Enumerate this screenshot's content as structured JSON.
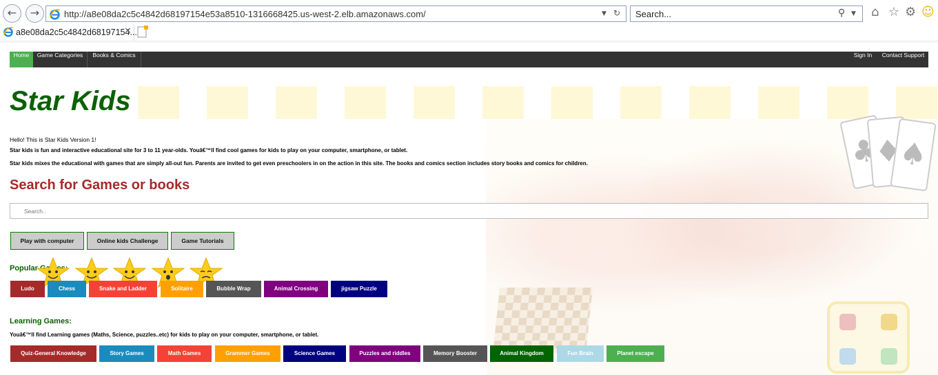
{
  "browser": {
    "url": "http://a8e08da2c5c4842d68197154e53a8510-1316668425.us-west-2.elb.amazonaws.com/",
    "search_placeholder": "Search...",
    "tab_title": "a8e08da2c5c4842d68197154...",
    "icons": [
      "back-arrow-icon",
      "forward-arrow-icon",
      "ie-logo-icon",
      "dropdown-icon",
      "refresh-icon",
      "search-icon",
      "home-icon",
      "star-icon",
      "gear-icon",
      "smiley-icon",
      "close-icon",
      "new-tab-icon"
    ]
  },
  "nav": {
    "home": "Home",
    "game_categories": "Game Categories",
    "books_comics": "Books & Comics",
    "sign_in": "Sign In",
    "contact_support": "Contact Support",
    "active_color": "#4caf50",
    "bar_color": "#333333"
  },
  "site": {
    "title": "Star Kids",
    "intro_1": "Hello! This is Star Kids Version 1!",
    "intro_2": "Star kids is fun and interactive educational site for 3 to 11 year-olds. Youâ€™ll find cool games for kids to play on your computer, smartphone, or tablet.",
    "intro_3": "Star kids mixes the educational with games that are simply all-out fun. Parents are invited to get even preschoolers in on the action in this site. The books and comics section includes story books and comics for children."
  },
  "search": {
    "heading": "Search for Games or books",
    "placeholder": "Search.."
  },
  "tabs": [
    {
      "label": "Play with computer"
    },
    {
      "label": "Online kids Challenge"
    },
    {
      "label": "Game Tutorials"
    }
  ],
  "popular": {
    "heading": "Popular Games:",
    "items": [
      {
        "label": "Ludo",
        "color": "#a52a2a"
      },
      {
        "label": "Chess",
        "color": "#1a8bbd"
      },
      {
        "label": "Snake and Ladder",
        "color": "#f44336"
      },
      {
        "label": "Solitaire",
        "color": "#ffa000"
      },
      {
        "label": "Bubble Wrap",
        "color": "#555555"
      },
      {
        "label": "Animal Crossing",
        "color": "#800080"
      },
      {
        "label": "jigsaw Puzzle",
        "color": "#000080"
      }
    ]
  },
  "learning": {
    "heading": "Learning Games:",
    "description": "Youâ€™ll find Learning games (Maths, Science, puzzles..etc) for kids to play on your computer, smartphone, or tablet.",
    "items": [
      {
        "label": "Quiz-General Knowledge",
        "color": "#a52a2a"
      },
      {
        "label": "Story Games",
        "color": "#1a8bbd"
      },
      {
        "label": "Math Games",
        "color": "#f44336"
      },
      {
        "label": "Grammer Games",
        "color": "#ffa000"
      },
      {
        "label": "Science Games",
        "color": "#000080"
      },
      {
        "label": "Puzzles and riddles",
        "color": "#800080"
      },
      {
        "label": "Memory Booster",
        "color": "#555555"
      },
      {
        "label": "Animal Kingdom",
        "color": "#006400"
      },
      {
        "label": "Fun Brain",
        "color": "#add8e6"
      },
      {
        "label": "Planet escape",
        "color": "#4caf50"
      }
    ]
  }
}
